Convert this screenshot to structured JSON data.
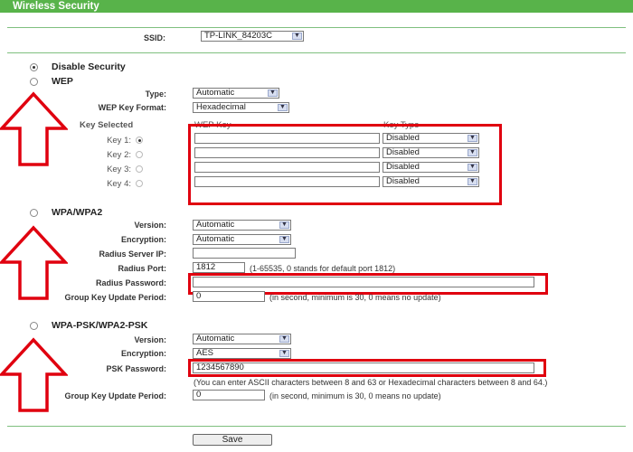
{
  "title": "Wireless Security",
  "ssid": {
    "label": "SSID:",
    "value": "TP-LINK_84203C"
  },
  "disable": {
    "label": "Disable Security"
  },
  "wep": {
    "label": "WEP",
    "type_label": "Type:",
    "type_value": "Automatic",
    "format_label": "WEP Key Format:",
    "format_value": "Hexadecimal",
    "key_selected": "Key Selected",
    "col_key": "WEP Key",
    "col_type": "Key Type",
    "keys": [
      {
        "label": "Key 1:",
        "value": "",
        "type": "Disabled"
      },
      {
        "label": "Key 2:",
        "value": "",
        "type": "Disabled"
      },
      {
        "label": "Key 3:",
        "value": "",
        "type": "Disabled"
      },
      {
        "label": "Key 4:",
        "value": "",
        "type": "Disabled"
      }
    ]
  },
  "wpa": {
    "label": "WPA/WPA2",
    "version_label": "Version:",
    "version_value": "Automatic",
    "encryption_label": "Encryption:",
    "encryption_value": "Automatic",
    "radius_ip_label": "Radius Server IP:",
    "radius_ip_value": "",
    "radius_port_label": "Radius Port:",
    "radius_port_value": "1812",
    "radius_port_note": "(1-65535, 0 stands for default port 1812)",
    "radius_pw_label": "Radius Password:",
    "radius_pw_value": "",
    "gk_label": "Group Key Update Period:",
    "gk_value": "0",
    "gk_note": "(in second, minimum is 30, 0 means no update)"
  },
  "psk": {
    "label": "WPA-PSK/WPA2-PSK",
    "version_label": "Version:",
    "version_value": "Automatic",
    "encryption_label": "Encryption:",
    "encryption_value": "AES",
    "pw_label": "PSK Password:",
    "pw_value": "1234567890",
    "pw_note": "(You can enter ASCII characters between 8 and 63 or Hexadecimal characters between 8 and 64.)",
    "gk_label": "Group Key Update Period:",
    "gk_value": "0",
    "gk_note": "(in second, minimum is 30, 0 means no update)"
  },
  "save_label": "Save",
  "colors": {
    "title_bar": "#58b34a",
    "highlight": "#e0000f",
    "arrow": "#e0000f"
  }
}
